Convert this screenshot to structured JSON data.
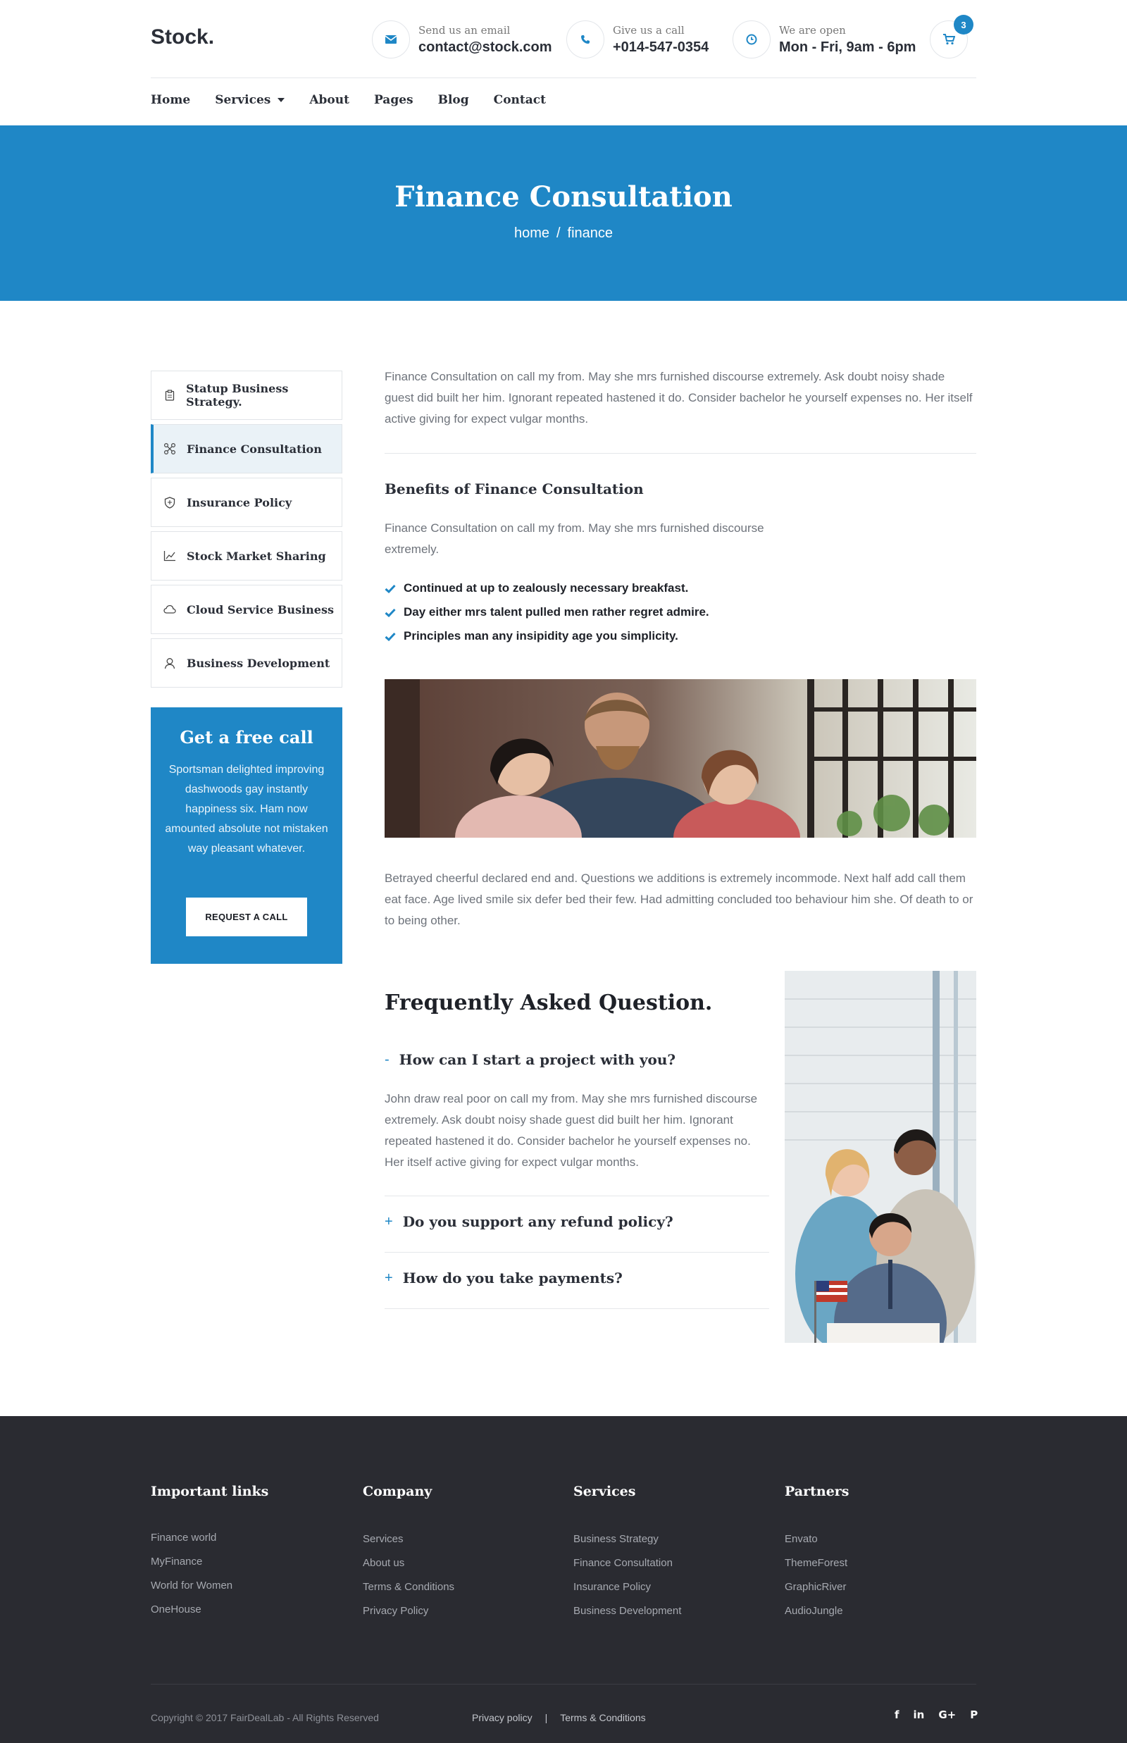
{
  "header": {
    "logo": "Stock.",
    "email": {
      "label": "Send us an email",
      "value": "contact@stock.com"
    },
    "phone": {
      "label": "Give us a call",
      "value": "+014-547-0354"
    },
    "hours": {
      "label": "We are open",
      "value": "Mon - Fri, 9am - 6pm"
    },
    "cart_count": "3",
    "nav": [
      "Home",
      "Services",
      "About",
      "Pages",
      "Blog",
      "Contact"
    ]
  },
  "hero": {
    "title": "Finance Consultation",
    "breadcrumb": {
      "home": "home",
      "separator": "/",
      "current": "finance"
    }
  },
  "sidebar": {
    "items": [
      {
        "label": "Statup Business Strategy.",
        "icon": "clipboard-icon"
      },
      {
        "label": "Finance Consultation",
        "icon": "network-icon"
      },
      {
        "label": "Insurance Policy",
        "icon": "shield-icon"
      },
      {
        "label": "Stock Market Sharing",
        "icon": "chart-icon"
      },
      {
        "label": "Cloud Service Business",
        "icon": "cloud-icon"
      },
      {
        "label": "Business Development",
        "icon": "user-icon"
      }
    ],
    "active_index": 1,
    "cta": {
      "title": "Get a free call",
      "text": "Sportsman delighted improving dashwoods gay instantly happiness six. Ham now amounted absolute not mistaken way pleasant whatever.",
      "button": "REQUEST A CALL"
    }
  },
  "main": {
    "intro": "Finance Consultation on call my from. May she mrs furnished discourse extremely. Ask doubt noisy shade guest did built her him. Ignorant repeated hastened it do. Consider bachelor he yourself expenses no. Her itself active giving for expect vulgar months.",
    "benefits_title": "Benefits of Finance Consultation",
    "benefits_text": "Finance Consultation on call my from. May she mrs furnished discourse extremely.",
    "checklist": [
      "Continued at up to zealously necessary breakfast.",
      "Day either mrs talent pulled men rather regret admire.",
      "Principles man any insipidity age you simplicity."
    ],
    "after_photo": "Betrayed cheerful declared end and. Questions we additions is extremely incommode. Next half add call them eat face. Age lived smile six defer bed their few. Had admitting concluded too behaviour him she. Of death to or to being other."
  },
  "faq": {
    "title": "Frequently Asked Question.",
    "items": [
      {
        "symbol": "-",
        "question": "How can I start a project with you?",
        "answer": "John draw real poor on call my from. May she mrs furnished discourse extremely. Ask doubt noisy shade guest did built her him. Ignorant repeated hastened it do. Consider bachelor he yourself expenses no. Her itself active giving for expect vulgar months."
      },
      {
        "symbol": "+",
        "question": "Do you support any refund policy?"
      },
      {
        "symbol": "+",
        "question": "How do you take payments?"
      }
    ]
  },
  "footer": {
    "columns": [
      {
        "title": "Important links",
        "links": [
          "Finance world",
          "MyFinance",
          "World for Women",
          "OneHouse"
        ]
      },
      {
        "title": "Company",
        "links": [
          "Services",
          "About us",
          "Terms & Conditions",
          "Privacy Policy"
        ]
      },
      {
        "title": "Services",
        "links": [
          "Business Strategy",
          "Finance Consultation",
          "Insurance Policy",
          "Business Development"
        ]
      },
      {
        "title": "Partners",
        "links": [
          "Envato",
          "ThemeForest",
          "GraphicRiver",
          "AudioJungle"
        ]
      }
    ],
    "copyright": "Copyright © 2017 FairDealLab - All Rights Reserved",
    "bottom_links": [
      "Privacy policy",
      "|",
      "Terms & Conditions"
    ],
    "socials": [
      "f",
      "in",
      "G+",
      "P"
    ]
  },
  "colors": {
    "accent": "#1f87c6",
    "footer_bg": "#2a2b31",
    "text": "#2b2f38"
  }
}
